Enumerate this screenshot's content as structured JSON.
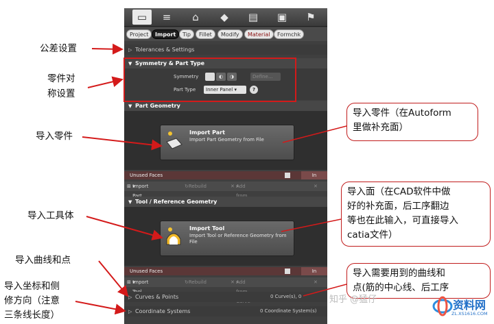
{
  "toolbar": {
    "icons": [
      "folder-icon",
      "settings-icon",
      "tool-icon",
      "diamond-icon",
      "stack-icon",
      "monitor-icon",
      "flag-icon"
    ]
  },
  "tabs": [
    "Project",
    "Import",
    "Tip",
    "Fillet",
    "Modify",
    "Material",
    "Formchk"
  ],
  "sections": {
    "tolerances": "Tolerances & Settings",
    "symmetry": "Symmetry & Part Type",
    "symmetry_label": "Symmetry",
    "define": "Define...",
    "part_type_label": "Part Type",
    "part_type_value": "Inner Panel",
    "help": "?",
    "part_geometry": "Part Geometry",
    "tool_geometry": "Tool / Reference Geometry",
    "curves": "Curves & Points",
    "curves_count": "0 Curve(s), 0",
    "coordinate": "Coordinate Systems",
    "coordinate_count": "0 Coordinate System(s)"
  },
  "import_part": {
    "title": "Import Part",
    "desc": "Import Part Geometry from File"
  },
  "import_tool": {
    "title": "Import Tool",
    "desc": "Import Tool or Reference Geometry from File"
  },
  "unused_faces": "Unused Faces",
  "in_label": "In",
  "part_row": {
    "import": "Import Part...",
    "rebuild": "Rebuild",
    "add": "Add from Curves"
  },
  "tool_row": {
    "import": "Import Tool...",
    "rebuild": "Rebuild",
    "add": "Add from Curve"
  },
  "annotations": {
    "a1": "公差设置",
    "a2a": "零件对",
    "a2b": "称设置",
    "a3": "导入零件",
    "a4": "导入工具体",
    "a5": "导入曲线和点",
    "a6a": "导入坐标和侧",
    "a6b": "修方向（注意",
    "a6c": "三条线长度）"
  },
  "bubbles": {
    "b1a": "导入零件（在Autoform",
    "b1b": "里做补充面）",
    "b2a": "导入面（在CAD软件中做",
    "b2b": "好的补充面，后工序翻边",
    "b2c": "等也在此输入，可直接导入",
    "b2d": "catia文件）",
    "b3a": "导入需要用到的曲线和",
    "b3b": "点(筋的中心线、后工序"
  },
  "watermark": "知乎 @猛仔",
  "logo": "资料网",
  "logo_url": "ZL.XS1616.COM"
}
